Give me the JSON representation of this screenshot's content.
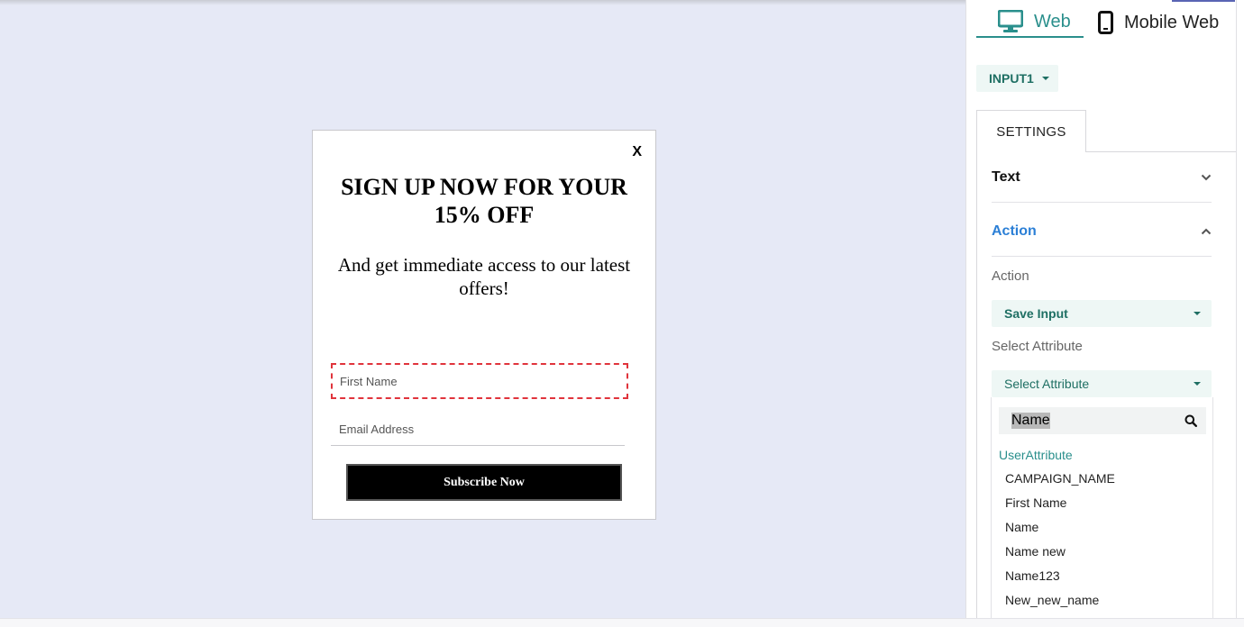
{
  "popup": {
    "close_label": "X",
    "title": "SIGN UP NOW FOR YOUR 15% OFF",
    "subtitle": "And get immediate access to our latest offers!",
    "first_name_placeholder": "First Name",
    "email_placeholder": "Email Address",
    "subscribe_label": "Subscribe Now"
  },
  "panel": {
    "device_tabs": [
      {
        "label": "Web",
        "icon": "monitor-icon",
        "active": true
      },
      {
        "label": "Mobile Web",
        "icon": "mobile-icon",
        "active": false
      }
    ],
    "element_selector": "INPUT1",
    "settings_tab": "SETTINGS",
    "sections": {
      "text": "Text",
      "action": "Action"
    },
    "action_label": "Action",
    "action_value": "Save Input",
    "attribute_label": "Select Attribute",
    "attribute_value": "Select Attribute",
    "search_value": "Name",
    "group_label": "UserAttribute",
    "options": [
      "CAMPAIGN_NAME",
      "First Name",
      "Name",
      "Name new",
      "Name123",
      "New_new_name"
    ]
  },
  "colors": {
    "accent": "#2a8f8c",
    "action_blue": "#2b7fd6",
    "canvas_bg": "#e6e9f6",
    "highlight_dashed": "#e0343c"
  }
}
